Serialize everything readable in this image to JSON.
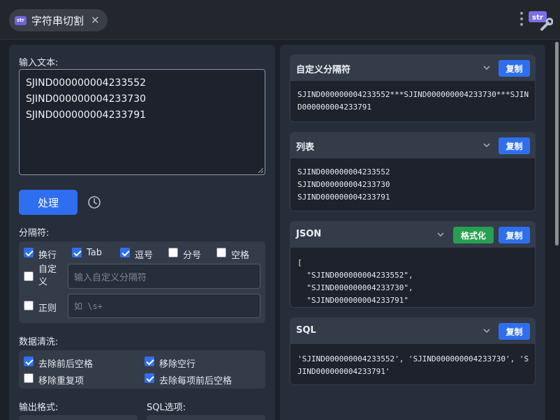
{
  "window": {
    "tab_title": "字符串切割",
    "tab_icon_text": "str",
    "logo_text": "str"
  },
  "input": {
    "label": "输入文本:",
    "lines": [
      "SJIND000000004233552",
      "SJIND000000004233730",
      "SJIND000000004233791"
    ],
    "process_button": "处理"
  },
  "delimiters": {
    "label": "分隔符:",
    "options": [
      {
        "label": "换行",
        "checked": true
      },
      {
        "label": "Tab",
        "checked": true
      },
      {
        "label": "逗号",
        "checked": true
      },
      {
        "label": "分号",
        "checked": false
      },
      {
        "label": "空格",
        "checked": false
      }
    ],
    "custom": {
      "label": "自定义",
      "checked": false,
      "placeholder": "输入自定义分隔符"
    },
    "regex": {
      "label": "正则",
      "checked": false,
      "placeholder": "如 \\s+"
    }
  },
  "cleaning": {
    "label": "数据清洗:",
    "options": [
      {
        "label": "去除前后空格",
        "checked": true
      },
      {
        "label": "移除空行",
        "checked": true
      },
      {
        "label": "移除重复项",
        "checked": false
      },
      {
        "label": "去除每项前后空格",
        "checked": true
      }
    ]
  },
  "output": {
    "format_label": "输出格式:",
    "sql_label": "SQL选项:"
  },
  "results": {
    "copy_label": "复制",
    "format_label": "格式化",
    "custom": {
      "title": "自定义分隔符",
      "content": "SJIND000000004233552***SJIND000000004233730***SJIND000000004233791"
    },
    "list": {
      "title": "列表",
      "lines": [
        "SJIND000000004233552",
        "SJIND000000004233730",
        "SJIND000000004233791"
      ]
    },
    "json": {
      "title": "JSON",
      "lines": [
        "[",
        "  \"SJIND000000004233552\",",
        "  \"SJIND000000004233730\",",
        "  \"SJIND000000004233791\""
      ]
    },
    "sql": {
      "title": "SQL",
      "content": "'SJIND000000004233552', 'SJIND000000004233730', 'SJIND000000004233791'"
    }
  },
  "colors": {
    "accent": "#2f6fef",
    "success": "#26a050",
    "panel": "#262d3b",
    "background": "#1c2028"
  }
}
